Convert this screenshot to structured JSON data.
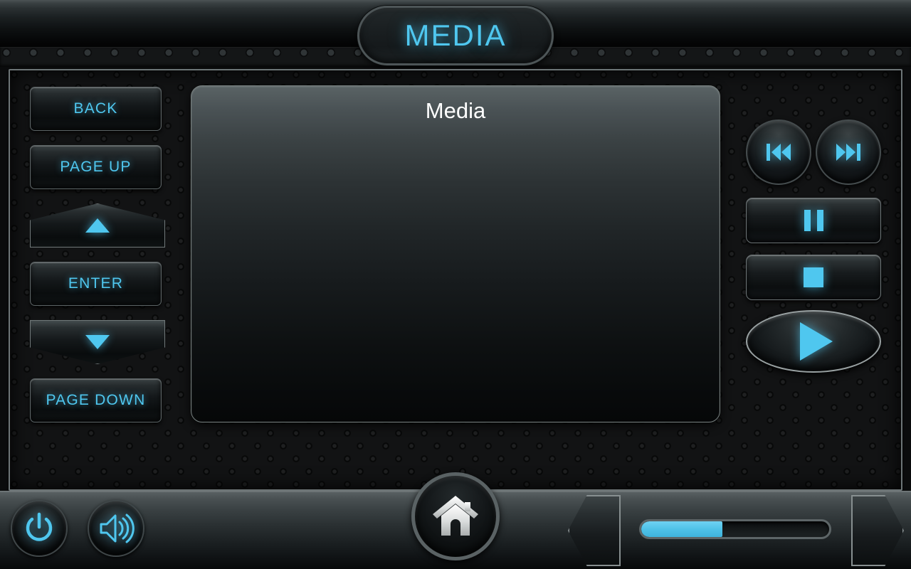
{
  "header": {
    "title": "MEDIA",
    "title_icon": "media-title-pill"
  },
  "main_panel": {
    "title": "Media",
    "content": ""
  },
  "nav_pad": {
    "back_label": "BACK",
    "page_up_label": "PAGE UP",
    "up_icon": "arrow-up-icon",
    "enter_label": "ENTER",
    "down_icon": "arrow-down-icon",
    "page_down_label": "PAGE DOWN"
  },
  "transport": {
    "previous_icon": "skip-previous-icon",
    "next_icon": "skip-next-icon",
    "pause_icon": "pause-icon",
    "stop_icon": "stop-icon",
    "play_icon": "play-icon"
  },
  "bottom_bar": {
    "power_icon": "power-icon",
    "volume_icon": "speaker-volume-icon",
    "home_icon": "home-icon",
    "prev_chevron_icon": "chevron-left-icon",
    "next_chevron_icon": "chevron-right-icon",
    "slider": {
      "name": "volume-slider",
      "value_percent": 43
    }
  },
  "colors": {
    "accent_cyan": "#4fc7ef",
    "panel_top": "#5a6365",
    "panel_bottom": "#060708",
    "frame_border": "#6d7577",
    "home_icon_fill": "#e8eaea"
  }
}
